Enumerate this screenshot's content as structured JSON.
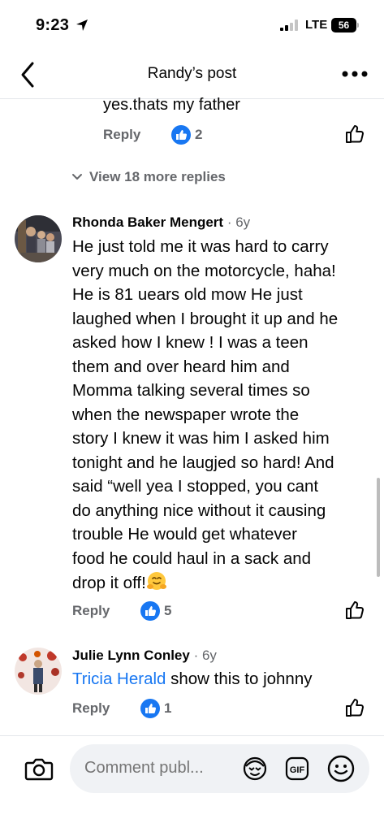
{
  "status_bar": {
    "time": "9:23",
    "network": "LTE",
    "battery": "56"
  },
  "header": {
    "title": "Randy’s post"
  },
  "comments": [
    {
      "text": "yes.thats my father",
      "reply_label": "Reply",
      "reaction_count": "2"
    }
  ],
  "view_more": {
    "label": "View 18 more replies"
  },
  "comment_main": {
    "author": "Rhonda Baker Mengert",
    "age": "6y",
    "lines": [
      "He just told me it was hard to carry",
      "very much on the motorcycle, haha!",
      "He is 81 uears old mow  He just",
      "laughed when I brought it up and he",
      "asked how I knew !  I was a teen",
      "them and over heard him and",
      "Momma talking several times so",
      "when the newspaper wrote the",
      "story I knew it was him  I asked him",
      "tonight and he laugjed so hard!  And",
      "said “well yea I stopped, you cant",
      "do anything nice without it causing",
      "trouble   He would get whatever",
      "food he could haul in a sack and",
      "drop it off!"
    ],
    "reply_label": "Reply",
    "reaction_count": "5"
  },
  "comment_second": {
    "author": "Julie Lynn Conley",
    "age": "6y",
    "mention": "Tricia Herald",
    "text": " show this to johnny",
    "reply_label": "Reply",
    "reaction_count": "1"
  },
  "composer": {
    "placeholder": "Comment publ..."
  },
  "icons": {
    "back": "chevron-left-icon",
    "more": "more-dots-icon",
    "like": "thumbs-up-outline-icon",
    "reaction": "like-reaction-icon",
    "camera": "camera-icon",
    "avatar_sticker": "avatar-sticker-icon",
    "gif": "gif-icon",
    "emoji": "smiley-icon"
  },
  "colors": {
    "accent": "#1877f2",
    "muted": "#65676b",
    "composer_bg": "#f0f2f5"
  }
}
